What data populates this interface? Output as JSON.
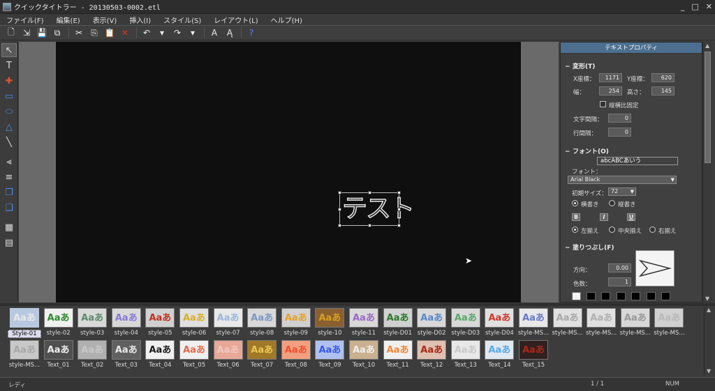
{
  "window": {
    "title": "クイックタイトラー - 20130503-0002.etl",
    "controls": [
      "_",
      "□",
      "✕"
    ]
  },
  "menu": [
    {
      "label": "ファイル(F)"
    },
    {
      "label": "編集(E)"
    },
    {
      "label": "表示(V)"
    },
    {
      "label": "挿入(I)"
    },
    {
      "label": "スタイル(S)"
    },
    {
      "label": "レイアウト(L)"
    },
    {
      "label": "ヘルプ(H)"
    }
  ],
  "toolbar": [
    {
      "name": "new-icon",
      "glyph": "🗋"
    },
    {
      "name": "open-icon",
      "glyph": "⇲"
    },
    {
      "name": "save-icon",
      "glyph": "💾"
    },
    {
      "name": "save-all-icon",
      "glyph": "⧉"
    },
    {
      "sep": true
    },
    {
      "name": "cut-icon",
      "glyph": "✂"
    },
    {
      "name": "copy-icon",
      "glyph": "⎘"
    },
    {
      "name": "paste-icon",
      "glyph": "📋"
    },
    {
      "name": "delete-icon",
      "glyph": "✕",
      "color": "#e03020"
    },
    {
      "sep": true
    },
    {
      "name": "undo-icon",
      "glyph": "↶"
    },
    {
      "name": "undo-dropdown-icon",
      "glyph": "▾"
    },
    {
      "name": "redo-icon",
      "glyph": "↷"
    },
    {
      "name": "redo-dropdown-icon",
      "glyph": "▾"
    },
    {
      "sep": true
    },
    {
      "name": "text-style-icon",
      "glyph": "A"
    },
    {
      "name": "text-effect-icon",
      "glyph": "Ą"
    },
    {
      "sep": true
    },
    {
      "name": "help-icon",
      "glyph": "?",
      "color": "#5588ff"
    }
  ],
  "lefttools": [
    {
      "name": "select-tool-icon",
      "glyph": "↖",
      "active": true
    },
    {
      "name": "text-tool-icon",
      "glyph": "T"
    },
    {
      "name": "crop-tool-icon",
      "glyph": "✚",
      "color": "#e05030"
    },
    {
      "name": "rectangle-tool-icon",
      "glyph": "▭",
      "color": "#4a8ef0"
    },
    {
      "name": "ellipse-tool-icon",
      "glyph": "⬭",
      "color": "#4a8ef0"
    },
    {
      "name": "triangle-tool-icon",
      "glyph": "△",
      "color": "#4a8ef0"
    },
    {
      "name": "line-tool-icon",
      "glyph": "╲"
    },
    {
      "name": "align-left-tool-icon",
      "glyph": "⫷"
    },
    {
      "name": "align-center-tool-icon",
      "glyph": "≡"
    },
    {
      "name": "bring-front-tool-icon",
      "glyph": "❐",
      "color": "#4a8ef0"
    },
    {
      "name": "send-back-tool-icon",
      "glyph": "❏",
      "color": "#4a8ef0"
    },
    {
      "name": "grid-tool-icon",
      "glyph": "▦"
    },
    {
      "name": "safe-area-tool-icon",
      "glyph": "▤"
    }
  ],
  "canvas": {
    "text": "テスト"
  },
  "props": {
    "title": "テキストプロパティ",
    "transform": {
      "header": "変形(T)",
      "x_label": "X座標：",
      "x_value": "1171",
      "y_label": "Y座標：",
      "y_value": "620",
      "w_label": "幅：",
      "w_value": "254",
      "h_label": "高さ：",
      "h_value": "145",
      "aspect_label": "縦横比固定",
      "char_spacing_label": "文字間隔：",
      "char_spacing_value": "0",
      "line_spacing_label": "行間隔：",
      "line_spacing_value": "0"
    },
    "font": {
      "header": "フォント(O)",
      "preview": "abcABCあいう",
      "font_label": "フォント：",
      "font_value": "Arial Black",
      "size_label": "初期サイズ：",
      "size_value": "72",
      "horizontal": "横書き",
      "vertical": "縦書き",
      "bold": "B",
      "italic": "I",
      "underline": "U",
      "align_left": "左揃え",
      "align_center": "中央揃え",
      "align_right": "右揃え"
    },
    "fill": {
      "header": "塗りつぶし(F)",
      "direction_label": "方向：",
      "direction_value": "0.00",
      "colors_label": "色数：",
      "colors_value": "1"
    }
  },
  "styles": {
    "row1": [
      {
        "label": "Style-01",
        "fg": "#e8e8e8",
        "bg": "#b8c8e0",
        "selected": true
      },
      {
        "label": "style-02",
        "fg": "#2a8a2a",
        "bg": "#f0f0f0"
      },
      {
        "label": "style-03",
        "fg": "#5a8a6a",
        "bg": "#d8d8d8"
      },
      {
        "label": "style-04",
        "fg": "#8878d8",
        "bg": "#d8d8d8"
      },
      {
        "label": "style-05",
        "fg": "#c03020",
        "bg": "#d0d0d0"
      },
      {
        "label": "style-06",
        "fg": "#d8b020",
        "bg": "#e0e0e0"
      },
      {
        "label": "style-07",
        "fg": "#9ab8d8",
        "bg": "#e8e8e8"
      },
      {
        "label": "style-08",
        "fg": "#7898c8",
        "bg": "#d8d8d8"
      },
      {
        "label": "style-09",
        "fg": "#e8a020",
        "bg": "#d0d0d0"
      },
      {
        "label": "style-10",
        "fg": "#d8a020",
        "bg": "#8a6030"
      },
      {
        "label": "style-11",
        "fg": "#9868c8",
        "bg": "#d8d8d8"
      },
      {
        "label": "style-D01",
        "fg": "#287828",
        "bg": "#d0d0d0"
      },
      {
        "label": "style-D02",
        "fg": "#5888c8",
        "bg": "#d8d8d8"
      },
      {
        "label": "style-D03",
        "fg": "#58a868",
        "bg": "#d8d8d8"
      },
      {
        "label": "style-D04",
        "fg": "#d03828",
        "bg": "#e0e0e0"
      },
      {
        "label": "style-MS...",
        "fg": "#6878c8",
        "bg": "#e8e8e8"
      },
      {
        "label": "style-MS...",
        "fg": "#a8a8a8",
        "bg": "#e0e0e0"
      },
      {
        "label": "style-MS...",
        "fg": "#b0b0b0",
        "bg": "#e0e0e0"
      },
      {
        "label": "style-MS...",
        "fg": "#989898",
        "bg": "#d8d8d8"
      },
      {
        "label": "style-MS...",
        "fg": "#b8b8b8",
        "bg": "#d0d0d0"
      }
    ],
    "row2": [
      {
        "label": "style-MS...",
        "fg": "#a8a8a8",
        "bg": "#c8c8c8"
      },
      {
        "label": "Text_01",
        "fg": "#f0f0f0",
        "bg": "#505050"
      },
      {
        "label": "Text_02",
        "fg": "#c8c8c8",
        "bg": "#b0b0b0"
      },
      {
        "label": "Text_03",
        "fg": "#e8e8e8",
        "bg": "#606060"
      },
      {
        "label": "Text_04",
        "fg": "#1a1a1a",
        "bg": "#f0f0f0"
      },
      {
        "label": "Text_05",
        "fg": "#e86848",
        "bg": "#f0f0f0"
      },
      {
        "label": "Text_06",
        "fg": "#f0c8c0",
        "bg": "#e8a898"
      },
      {
        "label": "Text_07",
        "fg": "#f0c850",
        "bg": "#a07828"
      },
      {
        "label": "Text_08",
        "fg": "#f05030",
        "bg": "#f0a080"
      },
      {
        "label": "Text_09",
        "fg": "#3858e8",
        "bg": "#b0c0f0"
      },
      {
        "label": "Text_10",
        "fg": "#f0f0f0",
        "bg": "#c8b090"
      },
      {
        "label": "Text_11",
        "fg": "#f08838",
        "bg": "#f0f0f0"
      },
      {
        "label": "Text_12",
        "fg": "#a82818",
        "bg": "#e0c0b0"
      },
      {
        "label": "Text_13",
        "fg": "#c8c8c8",
        "bg": "#e8e8e8"
      },
      {
        "label": "Text_14",
        "fg": "#58a8e8",
        "bg": "#e0e8f0"
      },
      {
        "label": "Text_15",
        "fg": "#a82818",
        "bg": "#302020"
      }
    ],
    "thumb_text": "Aaあ"
  },
  "status": {
    "left": "レディ",
    "page": "1 / 1",
    "num": "NUM"
  }
}
